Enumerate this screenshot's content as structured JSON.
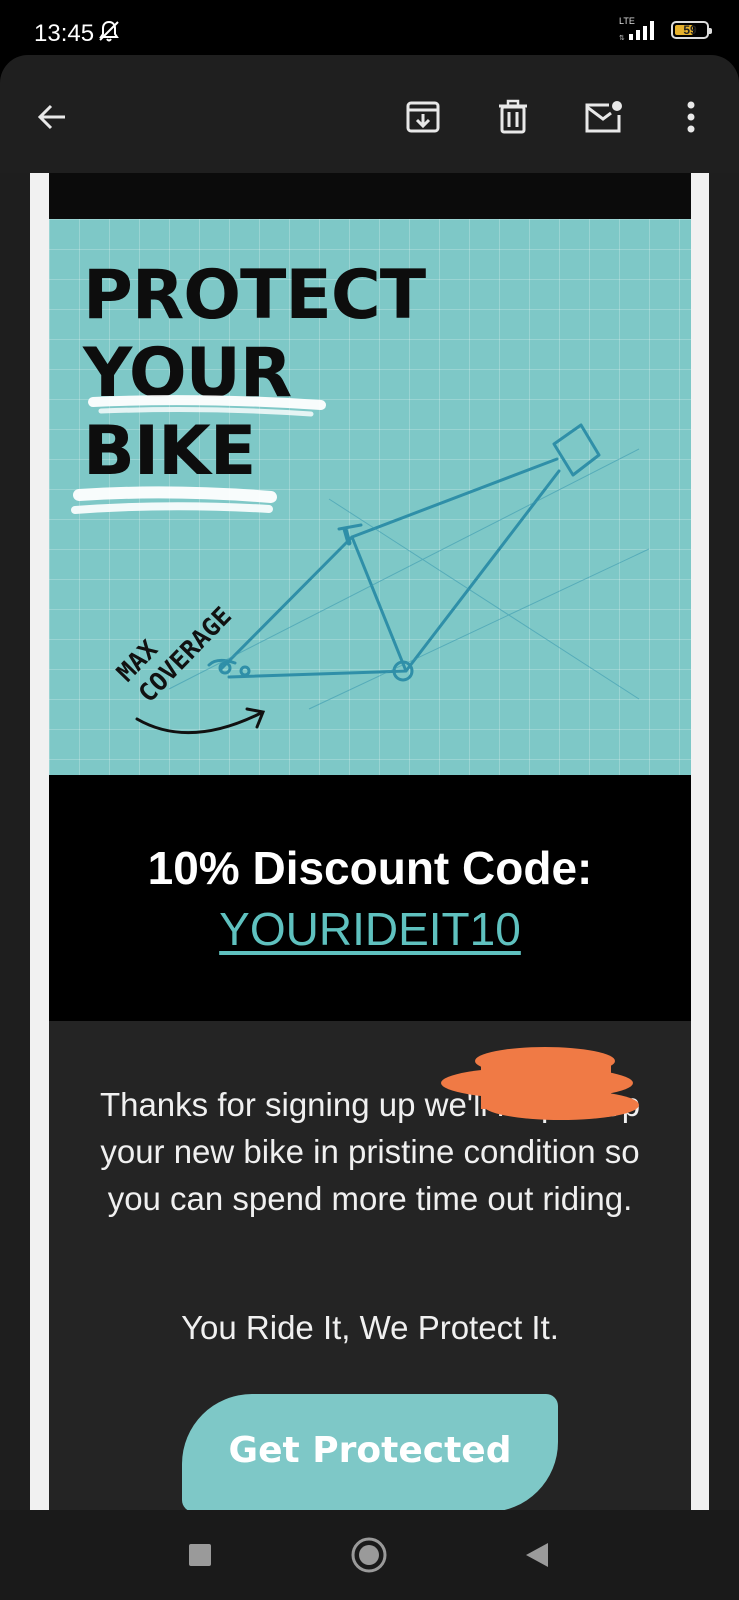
{
  "status_bar": {
    "time": "13:45",
    "network": "LTE",
    "battery": "59",
    "battery_level": 0.59
  },
  "toolbar": {
    "icons": [
      "back-arrow-icon",
      "archive-icon",
      "delete-icon",
      "mark-unread-icon",
      "more-vert-icon"
    ]
  },
  "hero": {
    "headline_lines": [
      "PROTECT",
      "YOUR",
      "BIKE"
    ],
    "badge_lines": [
      "MAX",
      "COVERAGE"
    ]
  },
  "discount": {
    "title": "10% Discount Code:",
    "code": "YOURIDEIT10"
  },
  "body": {
    "message": "Thanks for signing up we'll help keep your new bike in pristine condition so you can spend more time out riding.",
    "tagline": "You Ride It, We Protect It."
  },
  "cta": {
    "label": "Get Protected"
  },
  "colors": {
    "accent": "#7ec8c7",
    "link": "#5fc1bf",
    "redaction": "#f07a45"
  },
  "nav": {
    "icons": [
      "recents-square-icon",
      "home-circle-icon",
      "back-triangle-icon"
    ]
  }
}
